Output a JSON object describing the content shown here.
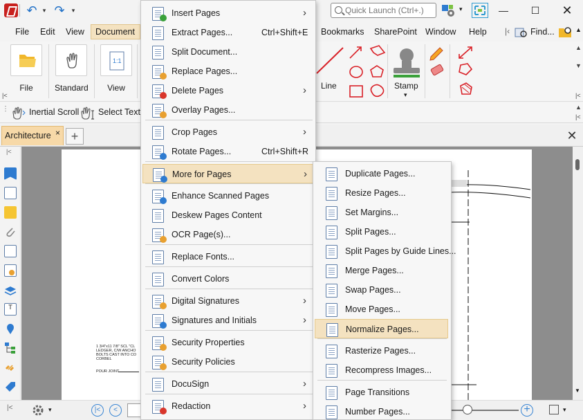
{
  "titlebar": {
    "quick_launch_placeholder": "Quick Launch (Ctrl+.)",
    "window_controls": [
      "minimize",
      "maximize",
      "close"
    ]
  },
  "menubar": {
    "left_items": [
      "File",
      "Edit",
      "View",
      "Document"
    ],
    "right_items": [
      "Bookmarks",
      "SharePoint",
      "Window",
      "Help"
    ],
    "find_label": "Find..."
  },
  "ribbon": {
    "file_label": "File",
    "standard_label": "Standard",
    "view_label": "View",
    "line_label": "Line",
    "stamp_label": "Stamp"
  },
  "toolbar2": {
    "inertial_scroll": "Inertial Scroll",
    "select_text": "Select Text/"
  },
  "tabs": {
    "document_tab": "Architecture",
    "close_glyph": "×",
    "add_glyph": "+"
  },
  "document_text": {
    "note_lines": [
      "1 3/4\"x11 7/8\" SCL \"CL",
      "LEDGER, C/W ANCHO",
      "BOLTS CAST INTO CO",
      "CORBEL"
    ],
    "pour_joint": "POUR JOINT"
  },
  "document_menu": {
    "items": [
      {
        "label": "Insert Pages",
        "shortcut": "",
        "submenu": true,
        "icon": "insert-pages-icon",
        "badge": "#3aa13a"
      },
      {
        "label": "Extract Pages...",
        "shortcut": "Ctrl+Shift+E",
        "submenu": false,
        "icon": "extract-pages-icon",
        "badge": ""
      },
      {
        "label": "Split Document...",
        "shortcut": "",
        "submenu": false,
        "icon": "split-document-icon",
        "badge": ""
      },
      {
        "label": "Replace Pages...",
        "shortcut": "",
        "submenu": false,
        "icon": "replace-pages-icon",
        "badge": "#e8a030"
      },
      {
        "label": "Delete Pages",
        "shortcut": "",
        "submenu": true,
        "icon": "delete-pages-icon",
        "badge": "#d9362b"
      },
      {
        "label": "Overlay Pages...",
        "shortcut": "",
        "submenu": false,
        "icon": "overlay-pages-icon",
        "badge": "#e8a030"
      },
      {
        "label": "Crop Pages",
        "shortcut": "",
        "submenu": true,
        "icon": "crop-pages-icon",
        "badge": ""
      },
      {
        "label": "Rotate Pages...",
        "shortcut": "Ctrl+Shift+R",
        "submenu": false,
        "icon": "rotate-pages-icon",
        "badge": "#2e7bd0"
      },
      {
        "label": "More for Pages",
        "shortcut": "",
        "submenu": true,
        "icon": "more-for-pages-icon",
        "badge": "#2e7bd0",
        "highlighted": true
      },
      {
        "label": "Enhance Scanned Pages",
        "shortcut": "",
        "submenu": false,
        "icon": "enhance-scanned-pages-icon",
        "badge": "#2e7bd0"
      },
      {
        "label": "Deskew Pages Content",
        "shortcut": "",
        "submenu": false,
        "icon": "deskew-pages-icon",
        "badge": ""
      },
      {
        "label": "OCR Page(s)...",
        "shortcut": "",
        "submenu": false,
        "icon": "ocr-pages-icon",
        "badge": "#e8a030"
      },
      {
        "label": "Replace Fonts...",
        "shortcut": "",
        "submenu": false,
        "icon": "replace-fonts-icon",
        "badge": ""
      },
      {
        "label": "Convert Colors",
        "shortcut": "",
        "submenu": false,
        "icon": "convert-colors-icon",
        "badge": ""
      },
      {
        "label": "Digital Signatures",
        "shortcut": "",
        "submenu": true,
        "icon": "digital-signatures-icon",
        "badge": "#e8a030"
      },
      {
        "label": "Signatures and Initials",
        "shortcut": "",
        "submenu": true,
        "icon": "signatures-initials-icon",
        "badge": "#2e7bd0"
      },
      {
        "label": "Security Properties",
        "shortcut": "",
        "submenu": false,
        "icon": "security-properties-icon",
        "badge": "#e8a030"
      },
      {
        "label": "Security Policies",
        "shortcut": "",
        "submenu": false,
        "icon": "security-policies-icon",
        "badge": "#e8a030"
      },
      {
        "label": "DocuSign",
        "shortcut": "",
        "submenu": true,
        "icon": "docusign-icon",
        "badge": ""
      },
      {
        "label": "Redaction",
        "shortcut": "",
        "submenu": true,
        "icon": "redaction-icon",
        "badge": "#d9362b"
      }
    ]
  },
  "more_for_pages_submenu": {
    "items": [
      {
        "label": "Duplicate Pages...",
        "icon": "duplicate-pages-icon"
      },
      {
        "label": "Resize Pages...",
        "icon": "resize-pages-icon"
      },
      {
        "label": "Set Margins...",
        "icon": "set-margins-icon"
      },
      {
        "label": "Split Pages...",
        "icon": "split-pages-icon"
      },
      {
        "label": "Split Pages by Guide Lines...",
        "icon": "split-pages-guide-lines-icon"
      },
      {
        "label": "Merge Pages...",
        "icon": "merge-pages-icon"
      },
      {
        "label": "Swap Pages...",
        "icon": "swap-pages-icon"
      },
      {
        "label": "Move Pages...",
        "icon": "move-pages-icon"
      },
      {
        "label": "Normalize Pages...",
        "icon": "normalize-pages-icon",
        "highlighted": true
      },
      {
        "label": "Rasterize Pages...",
        "icon": "rasterize-pages-icon"
      },
      {
        "label": "Recompress Images...",
        "icon": "recompress-images-icon"
      },
      {
        "label": "Page Transitions",
        "icon": "page-transitions-icon"
      },
      {
        "label": "Number Pages...",
        "icon": "number-pages-icon"
      }
    ]
  }
}
